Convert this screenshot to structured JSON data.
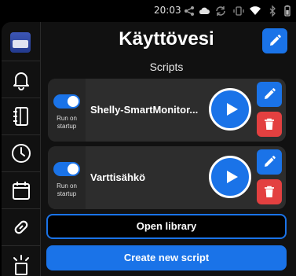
{
  "statusbar": {
    "time": "20:03",
    "icons": [
      "share-icon",
      "cloud-icon",
      "sync-icon",
      "vibrate-icon",
      "wifi-icon",
      "bluetooth-icon",
      "battery-icon"
    ]
  },
  "sidebar": {
    "logo": "app-logo",
    "items": [
      {
        "name": "notifications",
        "icon": "bell-icon"
      },
      {
        "name": "notebook",
        "icon": "notebook-icon"
      },
      {
        "name": "history",
        "icon": "clock-icon"
      },
      {
        "name": "calendar",
        "icon": "calendar-icon"
      },
      {
        "name": "links",
        "icon": "link-icon"
      },
      {
        "name": "alerts",
        "icon": "siren-icon"
      }
    ]
  },
  "header": {
    "title": "Käyttövesi",
    "subtitle": "Scripts"
  },
  "scripts": [
    {
      "name": "Shelly-SmartMonitor...",
      "run_on_startup_label": "Run on startup",
      "run_on_startup": true
    },
    {
      "name": "Varttisähkö",
      "run_on_startup_label": "Run on startup",
      "run_on_startup": true
    }
  ],
  "actions": {
    "open_library": "Open library",
    "create_new_script": "Create new script"
  },
  "colors": {
    "accent": "#1a73e8",
    "danger": "#e34040",
    "card": "#2d2d2d",
    "background": "#111111"
  }
}
